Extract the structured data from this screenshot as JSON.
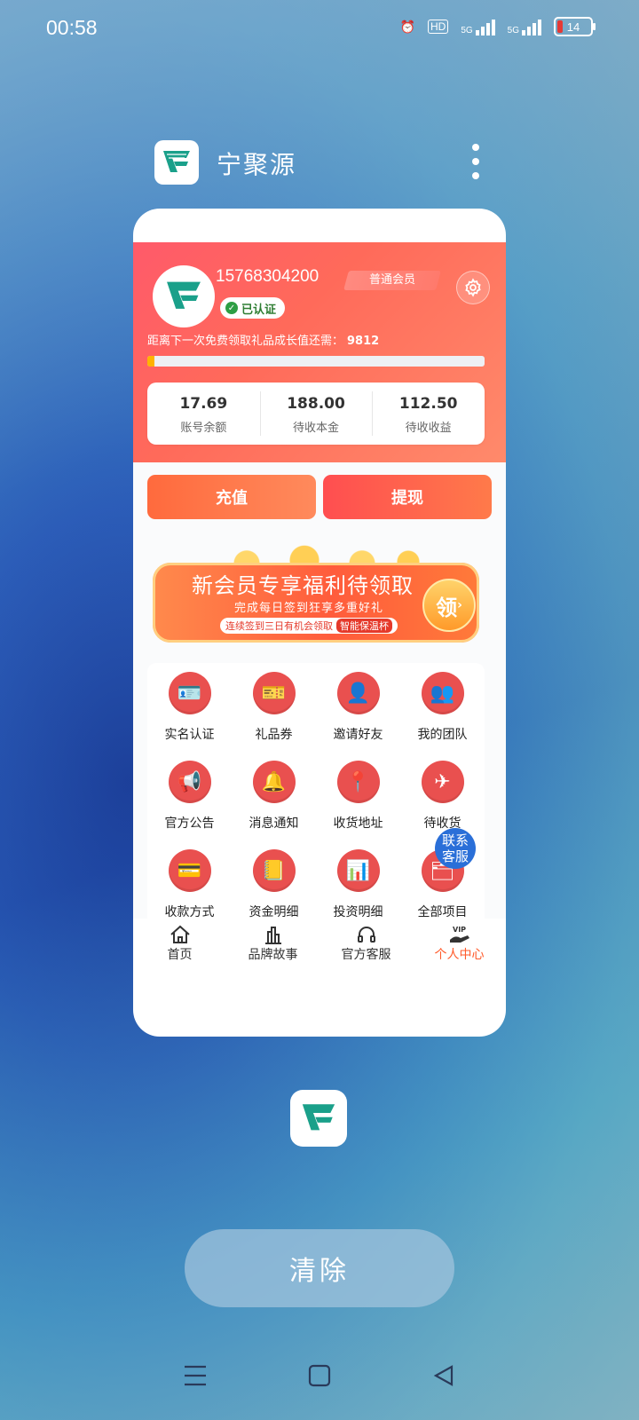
{
  "status_bar": {
    "time": "00:58",
    "hd": "HD",
    "net1": "5G",
    "net2": "5G",
    "battery": "14"
  },
  "app": {
    "title": "宁聚源"
  },
  "profile": {
    "phone": "15768304200",
    "verified_label": "已认证",
    "member_label": "普通会员",
    "growth_text": "距离下一次免费领取礼品成长值还需：",
    "growth_value": "9812",
    "growth_progress": 0.02
  },
  "stats": [
    {
      "value": "17.69",
      "label": "账号余额"
    },
    {
      "value": "188.00",
      "label": "待收本金"
    },
    {
      "value": "112.50",
      "label": "待收收益"
    }
  ],
  "actions": {
    "recharge": "充值",
    "withdraw": "提现"
  },
  "banner": {
    "title": "新会员专享福利待领取",
    "subtitle": "完成每日签到狂享多重好礼",
    "pill_text": "连续签到三日有机会领取",
    "pill_highlight": "智能保温杯",
    "claim": "领"
  },
  "menu": [
    {
      "label": "实名认证",
      "icon": "id-card-icon"
    },
    {
      "label": "礼品券",
      "icon": "coupon-icon"
    },
    {
      "label": "邀请好友",
      "icon": "invite-icon"
    },
    {
      "label": "我的团队",
      "icon": "team-icon"
    },
    {
      "label": "官方公告",
      "icon": "announcement-icon"
    },
    {
      "label": "消息通知",
      "icon": "bell-icon"
    },
    {
      "label": "收货地址",
      "icon": "location-icon"
    },
    {
      "label": "待收货",
      "icon": "delivery-icon"
    },
    {
      "label": "收款方式",
      "icon": "card-icon"
    },
    {
      "label": "资金明细",
      "icon": "ledger-icon"
    },
    {
      "label": "投资明细",
      "icon": "invest-icon"
    },
    {
      "label": "全部项目",
      "icon": "projects-icon"
    }
  ],
  "fab": {
    "label": "联系客服"
  },
  "tabs": [
    {
      "label": "首页",
      "icon": "home-icon"
    },
    {
      "label": "品牌故事",
      "icon": "building-icon"
    },
    {
      "label": "官方客服",
      "icon": "headset-icon"
    },
    {
      "label": "个人中心",
      "icon": "vip-hand-icon"
    }
  ],
  "clear_button": "清除",
  "colors": {
    "accent": "#ff5a2a",
    "hero": "#ff5a6a",
    "menu_icon_bg": "#e9504f",
    "fab": "#2a6fd8"
  }
}
